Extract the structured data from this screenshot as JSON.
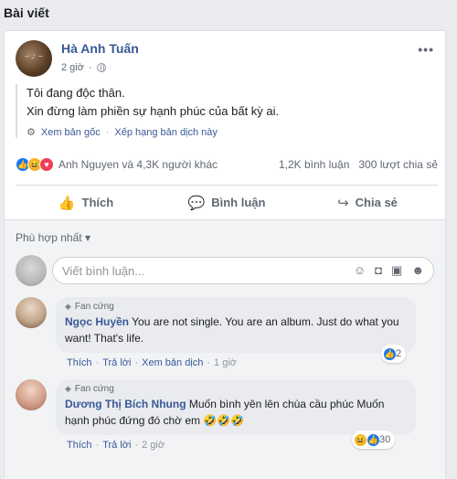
{
  "section_title": "Bài viết",
  "post": {
    "author": "Hà Anh Tuấn",
    "author_logo_text": "Hà Anh Tuấn",
    "time": "2 giờ",
    "lines": [
      "Tôi đang độc thân.",
      "Xin đừng làm phiền sự hạnh phúc của bất kỳ ai."
    ],
    "see_original": "Xem bản gốc",
    "rate_translation": "Xếp hạng bản dịch này",
    "reactions_text": "Anh Nguyen và 4,3K người khác",
    "comments_count": "1,2K bình luận",
    "shares_count": "300 lượt chia sẻ"
  },
  "actions": {
    "like": "Thích",
    "comment": "Bình luận",
    "share": "Chia sẻ"
  },
  "comments_section": {
    "sort_label": "Phù hợp nhất",
    "input_placeholder": "Viết bình luận...",
    "comments": [
      {
        "badge": "Fan cứng",
        "name": "Ngọc Huyền",
        "text": "You are not single. You are an album. Just do what you want! That's life.",
        "actions": [
          "Thích",
          "Trả lời",
          "Xem bản dịch"
        ],
        "time": "1 giờ",
        "reaction_count": "2"
      },
      {
        "badge": "Fan cứng",
        "name": "Dương Thị Bích Nhung",
        "text": "Muốn bình yên lên chùa cầu phúc Muốn hạnh phúc đứng đó chờ em 🤣🤣🤣",
        "actions": [
          "Thích",
          "Trả lời"
        ],
        "time": "2 giờ",
        "reaction_count": "30"
      }
    ]
  },
  "colors": {
    "link": "#385898",
    "like_blue": "#1877f2",
    "love_red": "#f33e58",
    "haha_yellow": "#f7b125"
  }
}
